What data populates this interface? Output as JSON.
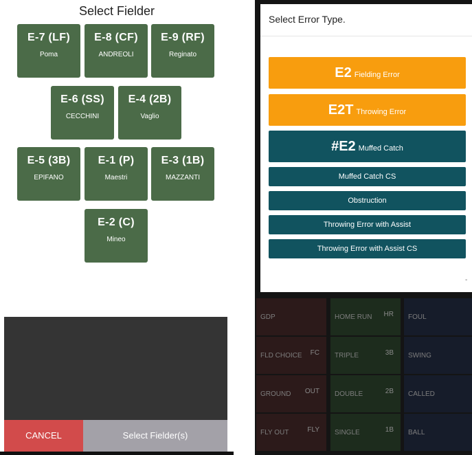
{
  "left_panel": {
    "title": "Select Fielder",
    "fielders": [
      {
        "pos": "E-7 (LF)",
        "name": "Poma"
      },
      {
        "pos": "E-8 (CF)",
        "name": "ANDREOLI"
      },
      {
        "pos": "E-9 (RF)",
        "name": "Reginato"
      },
      {
        "pos": "E-6 (SS)",
        "name": "CECCHINI"
      },
      {
        "pos": "E-4 (2B)",
        "name": "Vaglio"
      },
      {
        "pos": "E-5 (3B)",
        "name": "EPIFANO"
      },
      {
        "pos": "E-1 (P)",
        "name": "Maestri"
      },
      {
        "pos": "E-3 (1B)",
        "name": "MAZZANTI"
      },
      {
        "pos": "E-2 (C)",
        "name": "Mineo"
      }
    ],
    "cancel_label": "CANCEL",
    "select_label": "Select Fielder(s)"
  },
  "right_panel": {
    "dialog_title": "Select Error Type.",
    "errors": [
      {
        "code": "E2",
        "desc": "Fielding Error"
      },
      {
        "code": "E2T",
        "desc": "Throwing Error"
      },
      {
        "code": "#E2",
        "desc": "Muffed Catch"
      }
    ],
    "options": [
      "Muffed Catch CS",
      "Obstruction",
      "Throwing Error with Assist",
      "Throwing Error with Assist CS"
    ],
    "dash": "-",
    "grid": [
      {
        "label": "GDP",
        "icon": ""
      },
      {
        "label": "HOME RUN",
        "icon": "HR"
      },
      {
        "label": "FOUL",
        "icon": ""
      },
      {
        "label": "FLD CHOICE",
        "icon": "FC"
      },
      {
        "label": "TRIPLE",
        "icon": "3B"
      },
      {
        "label": "SWING",
        "icon": ""
      },
      {
        "label": "GROUND",
        "icon": "OUT"
      },
      {
        "label": "DOUBLE",
        "icon": "2B"
      },
      {
        "label": "CALLED",
        "icon": ""
      },
      {
        "label": "FLY OUT",
        "icon": "FLY"
      },
      {
        "label": "SINGLE",
        "icon": "1B"
      },
      {
        "label": "BALL",
        "icon": ""
      }
    ]
  },
  "colors": {
    "fielder_green": "#4b6b48",
    "cancel_red": "#d24b4b",
    "select_gray": "#a3a1a8",
    "error_orange": "#f89d0e",
    "error_teal": "#11535f"
  }
}
